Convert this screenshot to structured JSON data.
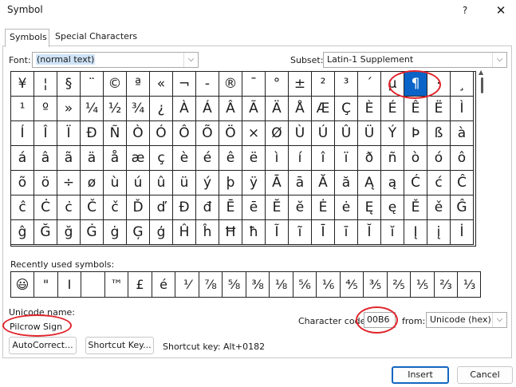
{
  "window": {
    "title": "Symbol",
    "help_glyph": "?",
    "close_glyph": "✕"
  },
  "tabs": [
    {
      "label": "Symbols",
      "active": true
    },
    {
      "label": "Special Characters",
      "active": false
    }
  ],
  "font": {
    "label": "Font:",
    "value": "(normal text)"
  },
  "subset": {
    "label": "Subset:",
    "value": "Latin-1 Supplement"
  },
  "symbols": [
    [
      "¥",
      "¦",
      "§",
      "¨",
      "©",
      "ª",
      "«",
      "¬",
      "-",
      "®",
      "¯",
      "°",
      "±",
      "²",
      "³",
      "´",
      "µ",
      "¶",
      "·",
      "¸"
    ],
    [
      "¹",
      "º",
      "»",
      "¼",
      "½",
      "¾",
      "¿",
      "À",
      "Á",
      "Â",
      "Ã",
      "Ä",
      "Å",
      "Æ",
      "Ç",
      "È",
      "É",
      "Ê",
      "Ë",
      "Ì"
    ],
    [
      "Í",
      "Î",
      "Ï",
      "Ð",
      "Ñ",
      "Ò",
      "Ó",
      "Ô",
      "Õ",
      "Ö",
      "×",
      "Ø",
      "Ù",
      "Ú",
      "Û",
      "Ü",
      "Ý",
      "Þ",
      "ß",
      "à"
    ],
    [
      "á",
      "â",
      "ã",
      "ä",
      "å",
      "æ",
      "ç",
      "è",
      "é",
      "ê",
      "ë",
      "ì",
      "í",
      "î",
      "ï",
      "ð",
      "ñ",
      "ò",
      "ó",
      "ô"
    ],
    [
      "õ",
      "ö",
      "÷",
      "ø",
      "ù",
      "ú",
      "û",
      "ü",
      "ý",
      "þ",
      "ÿ",
      "Ā",
      "ā",
      "Ă",
      "ă",
      "Ą",
      "ą",
      "Ć",
      "ć",
      "Ĉ"
    ],
    [
      "ĉ",
      "Ċ",
      "ċ",
      "Č",
      "č",
      "Ď",
      "ď",
      "Đ",
      "đ",
      "Ē",
      "ē",
      "Ĕ",
      "ĕ",
      "Ė",
      "ė",
      "Ę",
      "ę",
      "Ě",
      "ě",
      "Ĝ"
    ],
    [
      "ĝ",
      "Ğ",
      "ğ",
      "Ġ",
      "ġ",
      "Ģ",
      "ģ",
      "Ĥ",
      "ĥ",
      "Ħ",
      "ħ",
      "Ĩ",
      "ĩ",
      "Ī",
      "ī",
      "Ĭ",
      "ĭ",
      "Į",
      "į",
      "İ"
    ]
  ],
  "selected_symbol": "¶",
  "recent": {
    "label": "Recently used symbols:",
    "items": [
      "😃",
      "\"",
      "I",
      "",
      "™",
      "£",
      "é",
      "⅟",
      "⅞",
      "⅝",
      "⅜",
      "⅛",
      "⅚",
      "⅙",
      "⅘",
      "⅗",
      "⅖",
      "⅕",
      "⅔",
      "⅓"
    ]
  },
  "unicode_name": {
    "label": "Unicode name:",
    "value": "Pilcrow Sign"
  },
  "character_code": {
    "label": "Character code:",
    "value": "00B6"
  },
  "from": {
    "label": "from:",
    "value": "Unicode (hex)"
  },
  "buttons": {
    "autocorrect": "AutoCorrect...",
    "shortcut_key": "Shortcut Key...",
    "insert": "Insert",
    "cancel": "Cancel"
  },
  "shortcut_text": "Shortcut key: Alt+0182",
  "accent_color": "#0a64c8",
  "annotation_color": "#e0242b"
}
